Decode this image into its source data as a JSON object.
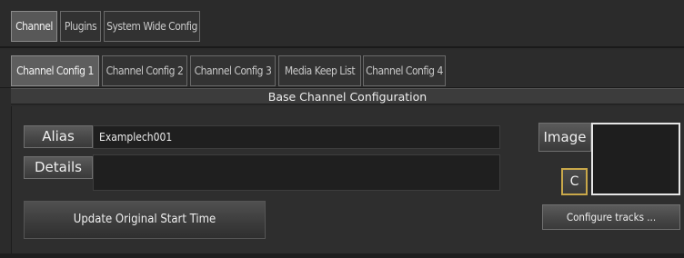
{
  "tabs": [
    {
      "label": "Channel",
      "active": true
    },
    {
      "label": "Plugins",
      "active": false
    },
    {
      "label": "System Wide Config",
      "active": false
    }
  ],
  "subtabs": [
    {
      "label": "Channel Config 1",
      "active": true
    },
    {
      "label": "Channel Config 2",
      "active": false
    },
    {
      "label": "Channel Config 3",
      "active": false
    },
    {
      "label": "Media Keep List",
      "active": false
    },
    {
      "label": "Channel Config 4",
      "active": false
    }
  ],
  "section": {
    "title": "Base Channel Configuration"
  },
  "alias": {
    "label": "Alias",
    "value": "Examplech001"
  },
  "details": {
    "label": "Details",
    "value": ""
  },
  "update_button": {
    "label": "Update Original Start Time"
  },
  "image": {
    "label": "Image"
  },
  "c_button": {
    "label": "C"
  },
  "configure_button": {
    "label": "Configure tracks ..."
  }
}
